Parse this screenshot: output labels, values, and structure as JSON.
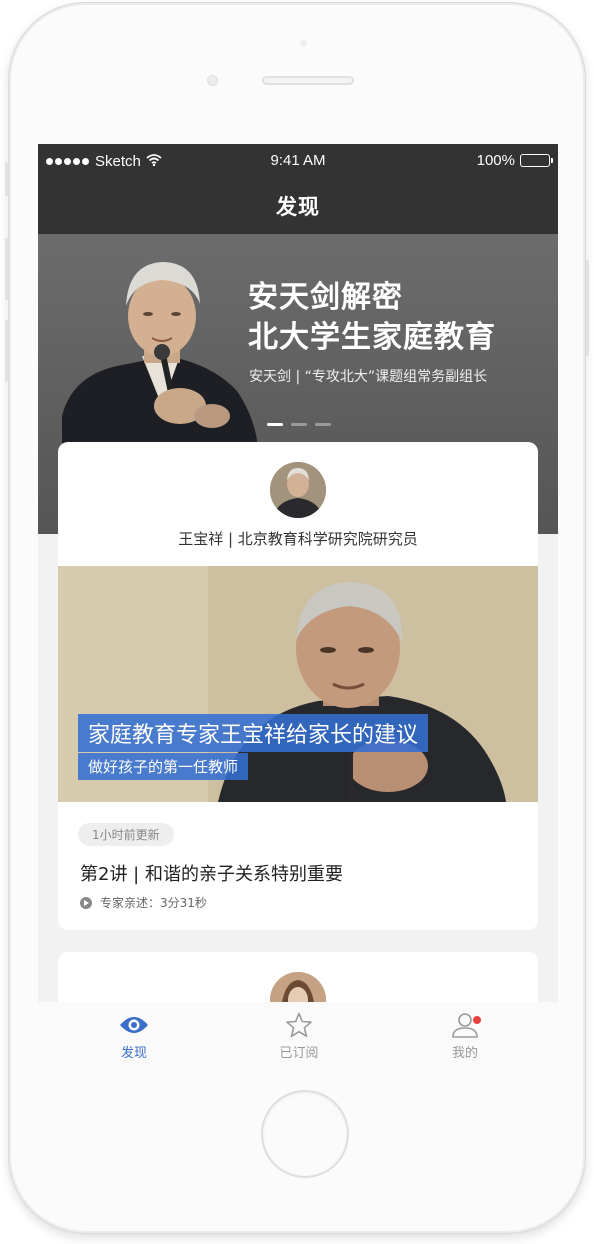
{
  "status_bar": {
    "carrier": "Sketch",
    "time": "9:41 AM",
    "battery": "100%"
  },
  "nav": {
    "title": "发现"
  },
  "banner": {
    "title_line1": "安天剑解密",
    "title_line2": "北大学生家庭教育",
    "subtitle": "安天剑 | “专攻北大”课题组常务副组长",
    "slide_count": 3,
    "active_slide": 1
  },
  "card1": {
    "author": "王宝祥 | 北京教育科学研究院研究员",
    "caption_main": "家庭教育专家王宝祥给家长的建议",
    "caption_sub": "做好孩子的第一任教师",
    "badge": "1小时前更新",
    "lesson_title": "第2讲 | 和谐的亲子关系特别重要",
    "play_text": "专家亲述：3分31秒"
  },
  "tabs": [
    {
      "label": "发现",
      "icon": "eye-icon",
      "active": true
    },
    {
      "label": "已订阅",
      "icon": "star-icon",
      "active": false
    },
    {
      "label": "我的",
      "icon": "user-icon",
      "active": false,
      "notification": true
    }
  ],
  "colors": {
    "accent": "#3a6fc9",
    "nav_bg": "#333333",
    "notification": "#e84040"
  }
}
